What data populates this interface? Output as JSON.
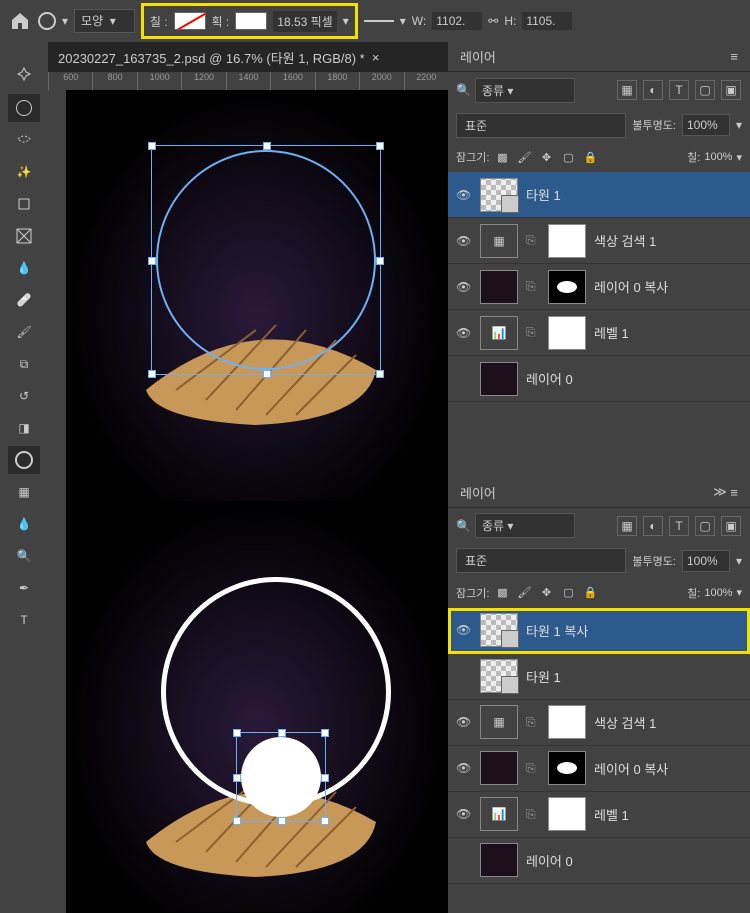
{
  "options": {
    "shape_label": "모양",
    "fill_label": "칠 :",
    "stroke_label": "획 :",
    "stroke_width": "18.53",
    "stroke_unit": "픽셀",
    "w_label": "W:",
    "w_value": "1102.",
    "h_label": "H:",
    "h_value": "1105."
  },
  "tab": {
    "title": "20230227_163735_2.psd @ 16.7% (타원 1, RGB/8) *"
  },
  "ruler": [
    "600",
    "800",
    "1000",
    "1200",
    "1400",
    "1600",
    "1800",
    "2000",
    "2200"
  ],
  "panel1": {
    "title": "레이어",
    "filter_label": "종류",
    "blend_mode": "표준",
    "opacity_label": "불투명도:",
    "opacity_value": "100%",
    "lock_label": "잠그기:",
    "fill_label": "칠:",
    "fill_value": "100%",
    "layers": [
      {
        "name": "타원 1"
      },
      {
        "name": "색상 검색 1"
      },
      {
        "name": "레이어 0 복사"
      },
      {
        "name": "레벨 1"
      },
      {
        "name": "레이어 0"
      }
    ]
  },
  "panel2": {
    "title": "레이어",
    "filter_label": "종류",
    "blend_mode": "표준",
    "opacity_label": "불투명도:",
    "opacity_value": "100%",
    "lock_label": "잠그기:",
    "fill_label": "칠:",
    "fill_value": "100%",
    "layers": [
      {
        "name": "타원 1 복사"
      },
      {
        "name": "타원 1"
      },
      {
        "name": "색상 검색 1"
      },
      {
        "name": "레이어 0 복사"
      },
      {
        "name": "레벨 1"
      },
      {
        "name": "레이어 0"
      }
    ]
  }
}
